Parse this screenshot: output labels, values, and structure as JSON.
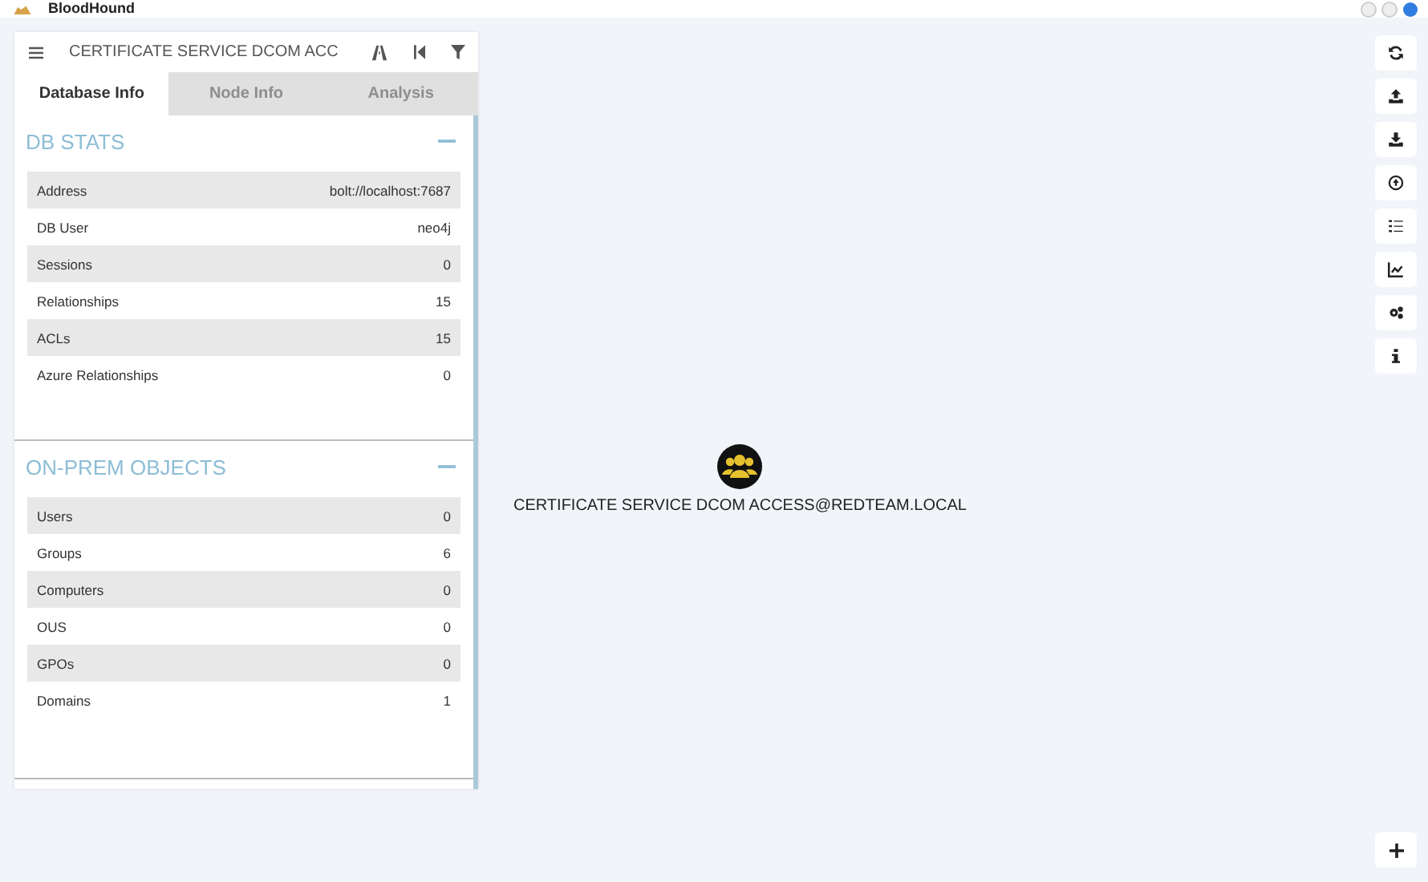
{
  "window": {
    "title": "BloodHound"
  },
  "search": {
    "value": "CERTIFICATE SERVICE DCOM ACC"
  },
  "tabs": [
    {
      "label": "Database Info",
      "selected": true
    },
    {
      "label": "Node Info",
      "selected": false
    },
    {
      "label": "Analysis",
      "selected": false
    }
  ],
  "sections": [
    {
      "title": "DB STATS",
      "expanded": true,
      "rows": [
        {
          "label": "Address",
          "value": "bolt://localhost:7687"
        },
        {
          "label": "DB User",
          "value": "neo4j"
        },
        {
          "label": "Sessions",
          "value": "0"
        },
        {
          "label": "Relationships",
          "value": "15"
        },
        {
          "label": "ACLs",
          "value": "15"
        },
        {
          "label": "Azure Relationships",
          "value": "0"
        }
      ]
    },
    {
      "title": "ON-PREM OBJECTS",
      "expanded": true,
      "rows": [
        {
          "label": "Users",
          "value": "0"
        },
        {
          "label": "Groups",
          "value": "6"
        },
        {
          "label": "Computers",
          "value": "0"
        },
        {
          "label": "OUS",
          "value": "0"
        },
        {
          "label": "GPOs",
          "value": "0"
        },
        {
          "label": "Domains",
          "value": "1"
        }
      ]
    }
  ],
  "graph": {
    "nodes": [
      {
        "kind": "group",
        "label": "CERTIFICATE SERVICE DCOM ACCESS@REDTEAM.LOCAL"
      }
    ]
  }
}
